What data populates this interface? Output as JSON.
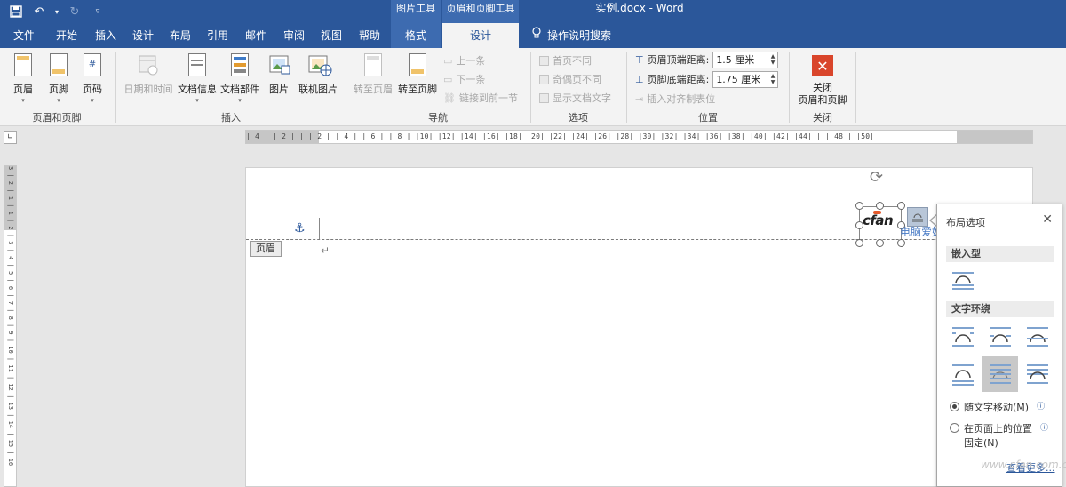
{
  "window": {
    "title": "实例.docx - Word"
  },
  "context_tabs": {
    "picture_tools": "图片工具",
    "header_footer_tools": "页眉和页脚工具"
  },
  "tabs": [
    {
      "label": "文件"
    },
    {
      "label": "开始"
    },
    {
      "label": "插入"
    },
    {
      "label": "设计"
    },
    {
      "label": "布局"
    },
    {
      "label": "引用"
    },
    {
      "label": "邮件"
    },
    {
      "label": "审阅"
    },
    {
      "label": "视图"
    },
    {
      "label": "帮助"
    },
    {
      "label": "格式"
    },
    {
      "label": "设计"
    }
  ],
  "search": {
    "label": "操作说明搜索",
    "icon": "lightbulb-icon"
  },
  "ribbon": {
    "group_hf": {
      "label": "页眉和页脚",
      "header": "页眉",
      "footer": "页脚",
      "page_number": "页码"
    },
    "group_insert": {
      "label": "插入",
      "datetime": "日期和时间",
      "docinfo": "文档信息",
      "quickparts": "文档部件",
      "picture": "图片",
      "online_picture": "联机图片"
    },
    "group_nav": {
      "label": "导航",
      "goto_header": "转至页眉",
      "goto_footer": "转至页脚",
      "prev": "上一条",
      "next": "下一条",
      "link_prev": "链接到前一节"
    },
    "group_options": {
      "label": "选项",
      "diff_first": "首页不同",
      "diff_odd_even": "奇偶页不同",
      "show_doc_text": "显示文档文字"
    },
    "group_position": {
      "label": "位置",
      "header_top_label": "页眉顶端距离:",
      "header_top_value": "1.5 厘米",
      "footer_bottom_label": "页脚底端距离:",
      "footer_bottom_value": "1.75 厘米",
      "insert_align_tab": "插入对齐制表位"
    },
    "group_close": {
      "label": "关闭",
      "close_line1": "关闭",
      "close_line2": "页眉和页脚"
    }
  },
  "ruler": {
    "h_text": "| 4 |  | 2 |  |  | 2 |  | 4 |  | 6 |  | 8 |  |10|  |12|  |14|  |16|  |18|  |20|  |22|  |24|  |26|  |28|  |30|  |32|  |34|  |36|  |38|  |40|  |42|  |44|  |  | 48 |  |50|",
    "v_text": "3 | 2 | 1 | 1 | 2 | 3 | 4 | 5 | 6 | 7 | 8 | 9 | 10 | 11 | 12 | 13 | 14 | 15 | 16"
  },
  "document": {
    "header_tag": "页眉",
    "paragraph_mark": "↵",
    "partial_text": "电脑爱好",
    "logo_text": "cfan"
  },
  "layout_pane": {
    "title": "布局选项",
    "inline_section": "嵌入型",
    "wrap_section": "文字环绕",
    "move_with_text": "随文字移动(M)",
    "fix_position_line1": "在页面上的位置",
    "fix_position_line2": "固定(N)",
    "see_more": "查看更多..."
  },
  "watermark": "www.cfan.com.cn",
  "colors": {
    "brand": "#2b579a",
    "ribbon_bg": "#f3f3f3",
    "close_red": "#d9452b"
  }
}
